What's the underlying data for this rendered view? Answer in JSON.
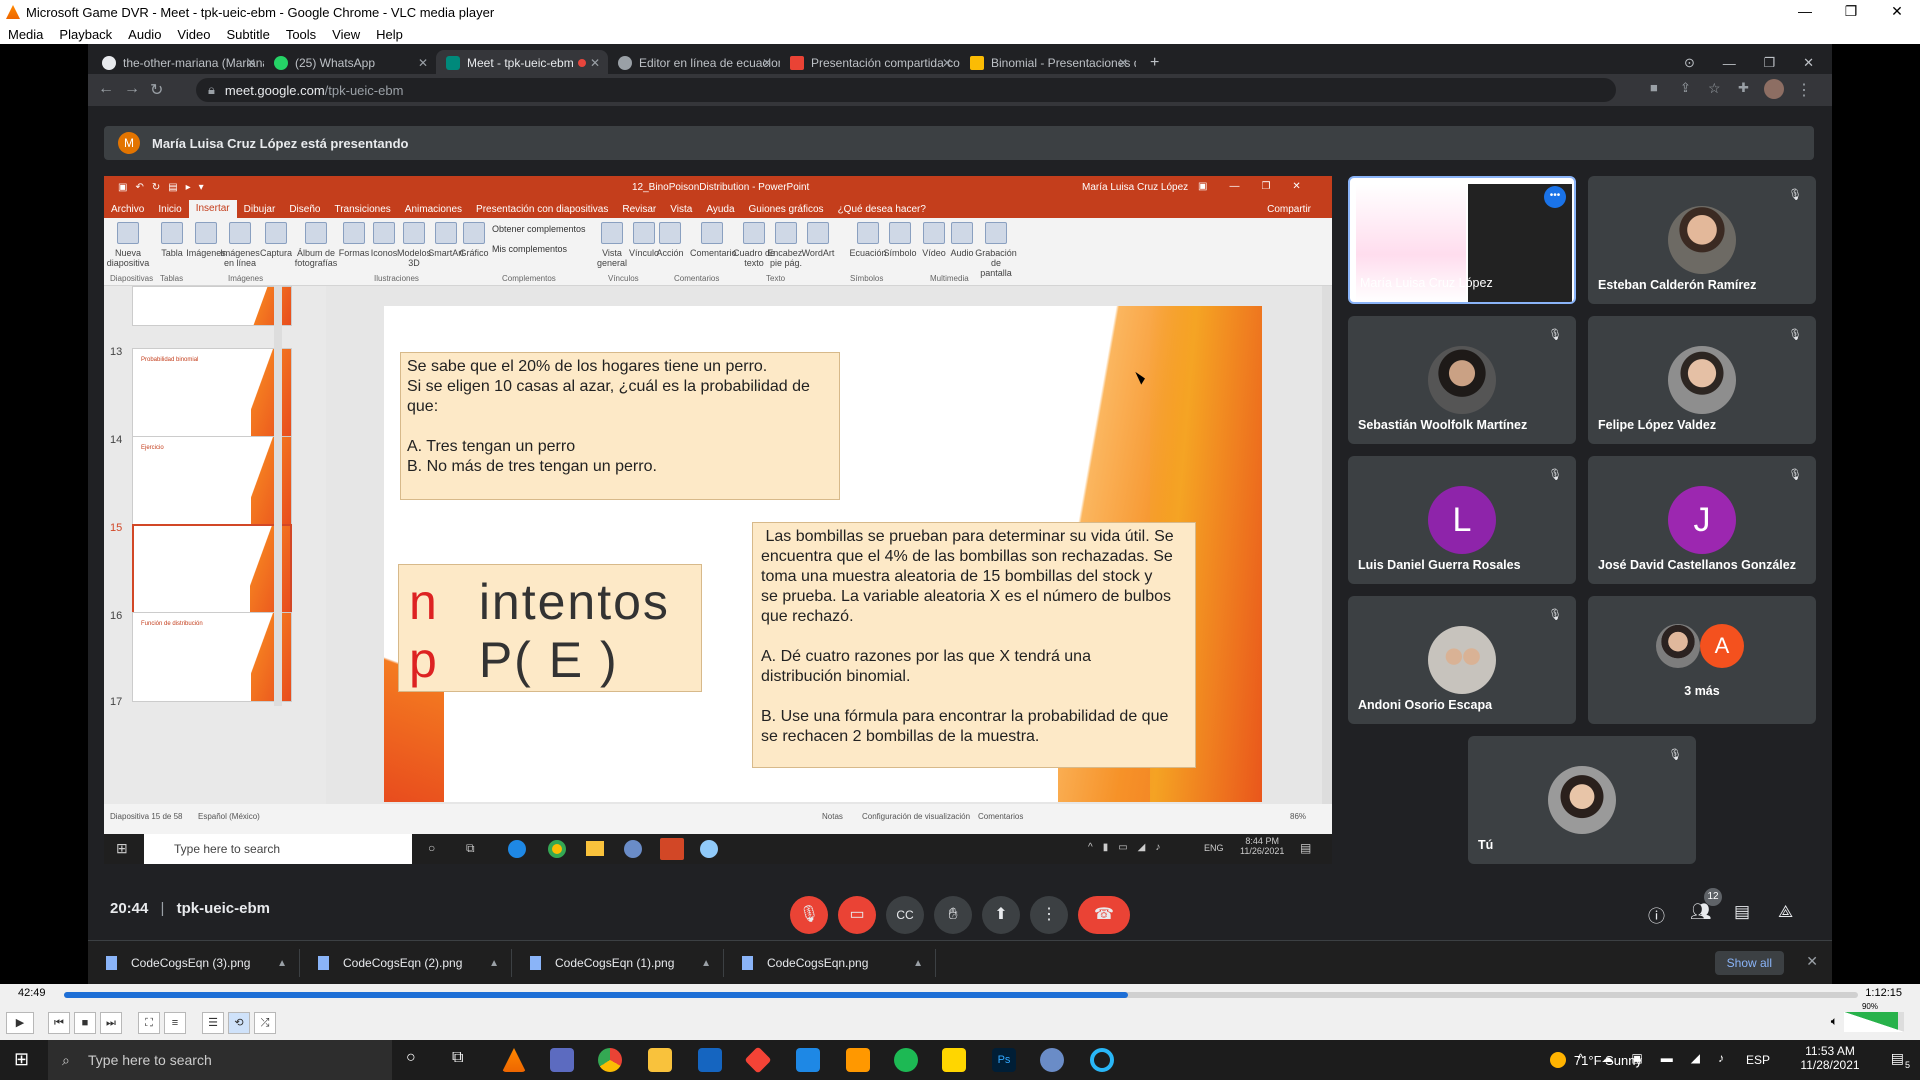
{
  "vlc": {
    "title": "Microsoft Game DVR - Meet - tpk-ueic-ebm - Google Chrome - VLC media player",
    "menu": [
      "Media",
      "Playback",
      "Audio",
      "Video",
      "Subtitle",
      "Tools",
      "View",
      "Help"
    ],
    "time_elapsed": "42:49",
    "time_total": "1:12:15",
    "progress": 0.593,
    "volume": "90%"
  },
  "chrome": {
    "tabs": [
      {
        "label": "the-other-mariana (Mariana Ával",
        "color": "#e8eaed"
      },
      {
        "label": "(25) WhatsApp",
        "color": "#25d366"
      },
      {
        "label": "Meet - tpk-ueic-ebm",
        "color": "#00897b",
        "active": true
      },
      {
        "label": "Editor en línea de ecuaciones Lat",
        "color": "#9aa0a6"
      },
      {
        "label": "Presentación compartida contigo",
        "color": "#ea4335"
      },
      {
        "label": "Binomial - Presentaciones de Go",
        "color": "#fbbc04"
      }
    ],
    "url_host": "meet.google.com",
    "url_path": "/tpk-ueic-ebm"
  },
  "meet": {
    "presenter_initial": "M",
    "presenting_text": "María Luisa Cruz López está presentando",
    "clock": "20:44",
    "meeting_code": "tpk-ueic-ebm",
    "participants_badge": "12",
    "participants": [
      {
        "name": "María Luisa Cruz López",
        "presenting": true
      },
      {
        "name": "Esteban Calderón Ramírez"
      },
      {
        "name": "Sebastián Woolfolk Martínez"
      },
      {
        "name": "Felipe López Valdez"
      },
      {
        "name": "Luis Daniel Guerra Rosales",
        "initial": "L",
        "color": "#8e24aa"
      },
      {
        "name": "José David Castellanos González",
        "initial": "J",
        "color": "#9c27b0"
      },
      {
        "name": "Andoni Osorio Escapa"
      },
      {
        "name": "3 más",
        "initial": "A",
        "color": "#f4511e"
      },
      {
        "name": "Tú"
      }
    ]
  },
  "powerpoint": {
    "title": "12_BinoPoisonDistribution - PowerPoint",
    "user": "María Luisa Cruz López",
    "tabs": [
      "Archivo",
      "Inicio",
      "Insertar",
      "Dibujar",
      "Diseño",
      "Transiciones",
      "Animaciones",
      "Presentación con diapositivas",
      "Revisar",
      "Vista",
      "Ayuda",
      "Guiones gráficos",
      "¿Qué desea hacer?"
    ],
    "share": "Compartir",
    "ribbon_items": [
      "Nueva diapositiva",
      "Tabla",
      "Imágenes",
      "Imágenes en línea",
      "Captura",
      "Álbum de fotografías",
      "Formas",
      "Iconos",
      "Modelos 3D",
      "SmartArt",
      "Gráfico",
      "Vista general",
      "Vínculo",
      "Acción",
      "Comentario",
      "Cuadro de texto",
      "Encabez. pie pág.",
      "WordArt",
      "Ecuación",
      "Símbolo",
      "Vídeo",
      "Audio",
      "Grabación de pantalla"
    ],
    "ribbon_groups": [
      "Diapositivas",
      "Tablas",
      "Imágenes",
      "Ilustraciones",
      "Complementos",
      "Vínculos",
      "Comentarios",
      "Texto",
      "Símbolos",
      "Multimedia"
    ],
    "addins": [
      "Obtener complementos",
      "Mis complementos"
    ],
    "thumb_numbers": [
      "13",
      "14",
      "15",
      "16",
      "17"
    ],
    "thumb_titles": [
      "Probabilidad binomial",
      "Ejercicio",
      "",
      "Función de distribución",
      ""
    ],
    "status_left": "Diapositiva 15 de 58",
    "status_lang": "Español (México)",
    "status_right": [
      "Notas",
      "Configuración de visualización",
      "Comentarios"
    ],
    "zoom": "86%"
  },
  "slide": {
    "q1": [
      "Se sabe que el 20% de los hogares tiene un perro.",
      "Si se eligen 10 casas al azar, ¿cuál es la probabilidad de",
      "que:",
      "",
      "A. Tres tengan un perro",
      "B. No más de tres tengan un perro."
    ],
    "n_label": "n",
    "n_text": "intentos",
    "p_label": "p",
    "p_text": "P( E )",
    "q2": [
      " Las bombillas se prueban para determinar su vida útil. Se",
      "encuentra que el 4% de las bombillas son rechazadas. Se",
      "toma una muestra aleatoria de 15 bombillas del stock y",
      "se prueba. La variable aleatoria X es el número de bulbos",
      "que rechazó.",
      "",
      "A. Dé cuatro razones por las que X tendrá una",
      "distribución binomial.",
      "",
      "B. Use una fórmula para encontrar la probabilidad de que",
      "se rechacen 2 bombillas de la muestra."
    ]
  },
  "inner_taskbar": {
    "search": "Type here to search",
    "time": "8:44 PM",
    "date": "11/26/2021",
    "lang": "ENG"
  },
  "downloads": {
    "files": [
      "CodeCogsEqn (3).png",
      "CodeCogsEqn (2).png",
      "CodeCogsEqn (1).png",
      "CodeCogsEqn.png"
    ],
    "show_all": "Show all"
  },
  "taskbar": {
    "search": "Type here to search",
    "weather": "71°F  Sunny",
    "lang": "ESP",
    "time": "11:53 AM",
    "date": "11/28/2021",
    "notif": "5"
  }
}
